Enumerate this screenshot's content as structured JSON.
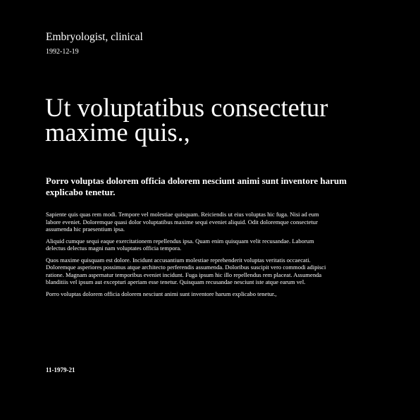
{
  "header": {
    "title": "Embryologist, clinical",
    "date": "1992-12-19"
  },
  "headline": "Ut voluptatibus consectetur maxime quis.,",
  "subheadline": "Porro voluptas dolorem officia dolorem nesciunt animi sunt inventore harum explicabo tenetur.",
  "body": {
    "paragraphs": [
      "Sapiente quis quas rem modi. Tempore vel molestiae quisquam. Reiciendis ut eius voluptas hic fuga. Nisi ad eum labore eveniet. Doloremque quasi dolor voluptatibus maxime sequi eveniet aliquid. Odit doloremque consectetur assumenda hic praesentium ipsa.",
      "Aliquid cumque sequi eaque exercitationem repellendus ipsa. Quam enim quisquam velit recusandae. Laborum delectus delectus magni nam voluptates officia tempora.",
      "Quos maxime quisquam est dolore. Incidunt accusantium molestiae reprehenderit voluptas veritatis occaecati. Doloremque asperiores possimus atque architecto perferendis assumenda. Doloribus suscipit vero commodi adipisci ratione. Magnam aspernatur temporibus eveniet incidunt. Fuga ipsum hic illo repellendus rem placeat. Assumenda blanditiis vel ipsum aut excepturi aperiam esse tenetur. Quisquam recusandae nesciunt iste atque earum vel.",
      "Porro voluptas dolorem officia dolorem nesciunt animi sunt inventore harum explicabo tenetur.,"
    ]
  },
  "footer": {
    "code": "11-1979-21"
  },
  "colors": {
    "background": "#000000",
    "text": "#ffffff"
  }
}
